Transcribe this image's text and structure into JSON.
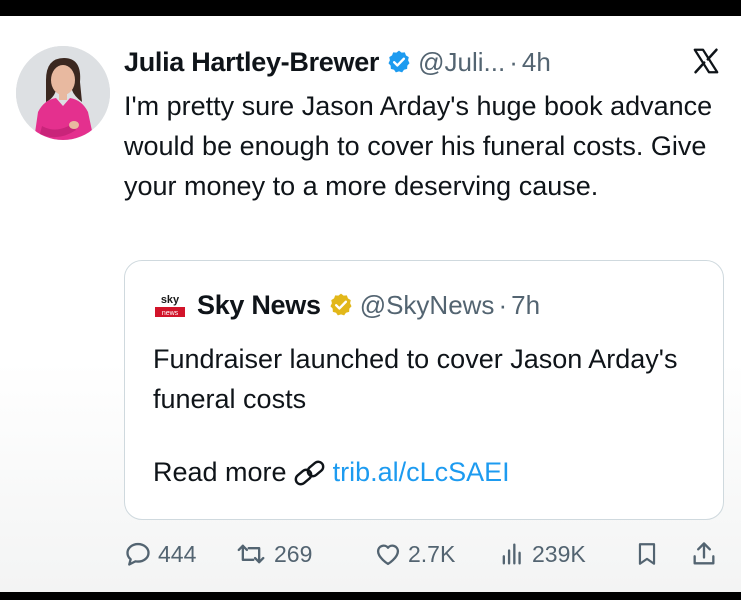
{
  "tweet": {
    "author_name": "Julia Hartley-Brewer",
    "handle": "@Juli...",
    "separator": "·",
    "time": "4h",
    "text": "I'm pretty sure Jason Arday's huge book advance would be enough to cover his funeral costs. Give your money to a more deserving cause."
  },
  "quote": {
    "author_name": "Sky News",
    "handle": "@SkyNews",
    "separator": "·",
    "time": "7h",
    "logo_text_top": "sky",
    "logo_text_bottom": "news",
    "text": "Fundraiser launched to cover Jason Arday's funeral costs",
    "read_more": "Read more",
    "link": "trib.al/cLcSAEI"
  },
  "actions": {
    "replies": "444",
    "reposts": "269",
    "likes": "2.7K",
    "views": "239K"
  },
  "colors": {
    "link_blue": "#1d9bf0",
    "verified_blue": "#1d9bf0",
    "verified_gold": "#e2b719",
    "muted_text": "#536471"
  }
}
